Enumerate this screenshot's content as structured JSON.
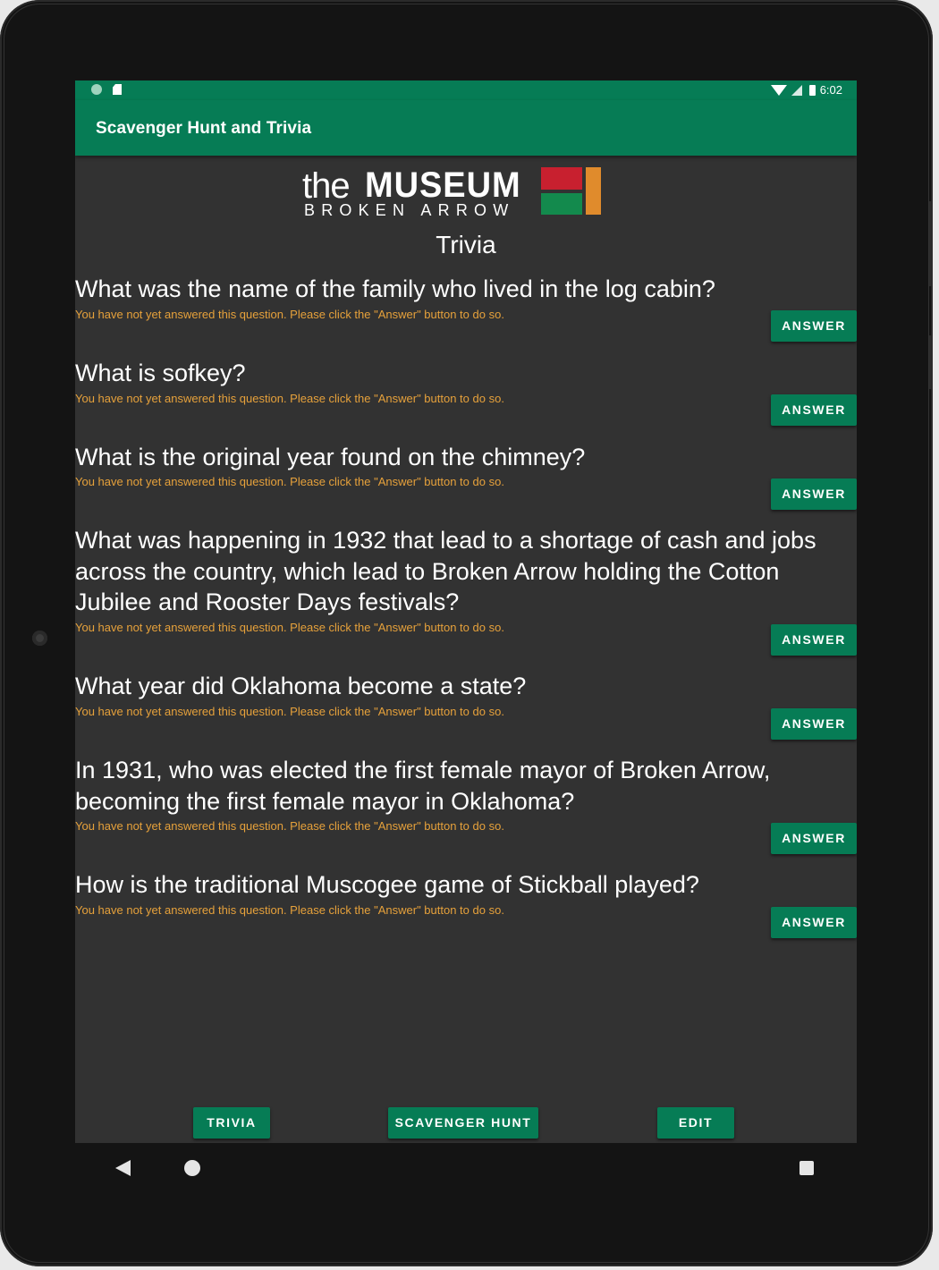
{
  "status_bar": {
    "time": "6:02"
  },
  "app_bar": {
    "title": "Scavenger Hunt and Trivia"
  },
  "logo": {
    "the": "the",
    "museum": "MUSEUM",
    "subtitle": "BROKEN ARROW"
  },
  "page": {
    "heading": "Trivia"
  },
  "status_message": "You have not yet answered this question. Please click the \"Answer\" button to do so.",
  "answer_label": "ANSWER",
  "questions": [
    {
      "text": "What was the name of the family who lived in the log cabin?"
    },
    {
      "text": "What is sofkey?"
    },
    {
      "text": "What is the original year found on the chimney?"
    },
    {
      "text": "What was happening in 1932 that lead to a shortage of cash and jobs across the country, which lead to Broken Arrow holding the Cotton Jubilee and Rooster Days festivals?"
    },
    {
      "text": "What year did Oklahoma become a state?"
    },
    {
      "text": "In 1931, who was elected the first female mayor of Broken Arrow, becoming the first female mayor in Oklahoma?"
    },
    {
      "text": "How is the traditional Muscogee game of Stickball played?"
    }
  ],
  "bottom_nav": {
    "trivia": "TRIVIA",
    "scavenger_hunt": "SCAVENGER HUNT",
    "edit": "EDIT"
  },
  "colors": {
    "primary": "#067c55",
    "background": "#323232",
    "status_text": "#e6a13b"
  }
}
